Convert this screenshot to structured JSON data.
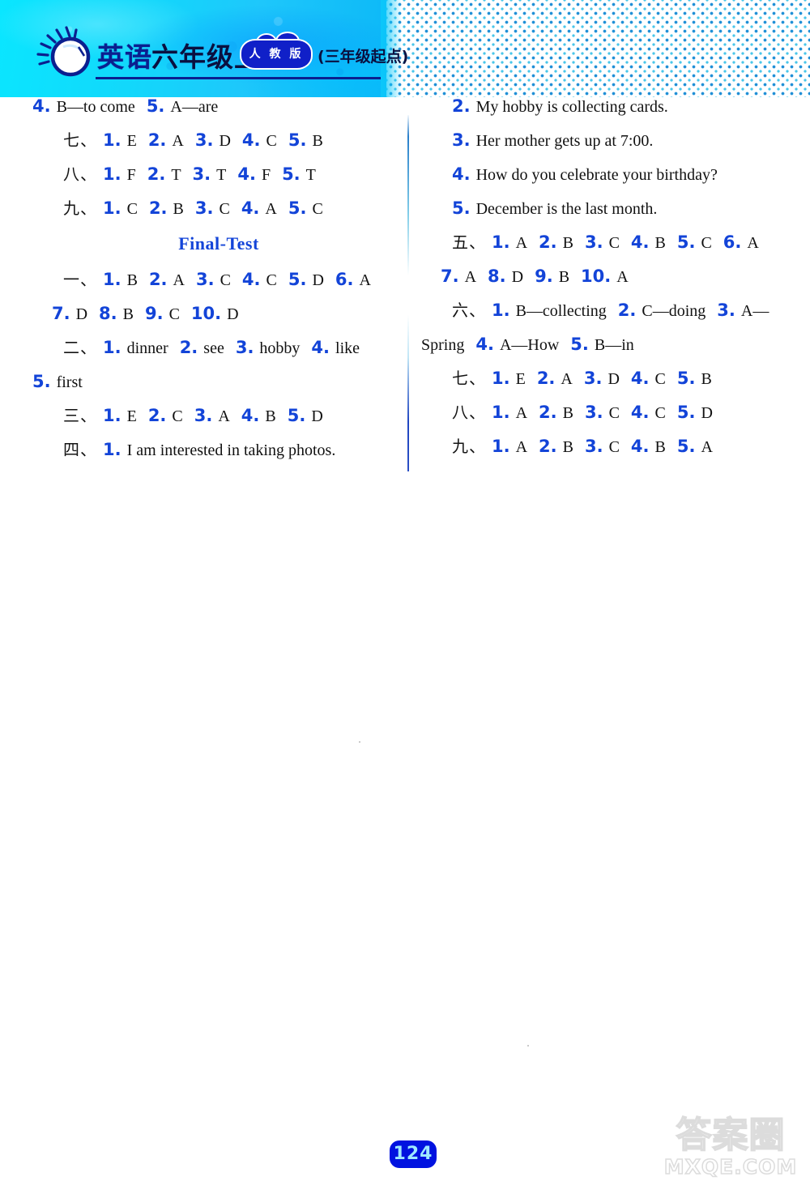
{
  "header": {
    "logo_icon": "sun-pearl-icon",
    "subject": "英语",
    "grade": "六年级上",
    "publisher_badge": "人 教 版",
    "edition_note": "(三年级起点)"
  },
  "left_column": {
    "lines": [
      {
        "id": "line-prev-4-5",
        "indent": "none",
        "parts": [
          {
            "type": "num",
            "text": "4."
          },
          {
            "type": "ans",
            "text": "B—to come"
          },
          {
            "type": "gap"
          },
          {
            "type": "num",
            "text": "5."
          },
          {
            "type": "ans",
            "text": "A—are"
          }
        ]
      },
      {
        "id": "line-section-7",
        "indent": "full",
        "parts": [
          {
            "type": "cn",
            "text": "七、"
          },
          {
            "type": "num",
            "text": "1."
          },
          {
            "type": "ans",
            "text": "E"
          },
          {
            "type": "gap"
          },
          {
            "type": "num",
            "text": "2."
          },
          {
            "type": "ans",
            "text": "A"
          },
          {
            "type": "gap"
          },
          {
            "type": "num",
            "text": "3."
          },
          {
            "type": "ans",
            "text": "D"
          },
          {
            "type": "gap"
          },
          {
            "type": "num",
            "text": "4."
          },
          {
            "type": "ans",
            "text": "C"
          },
          {
            "type": "gap"
          },
          {
            "type": "num",
            "text": "5."
          },
          {
            "type": "ans",
            "text": "B"
          }
        ]
      },
      {
        "id": "line-section-8",
        "indent": "full",
        "parts": [
          {
            "type": "cn",
            "text": "八、"
          },
          {
            "type": "num",
            "text": "1."
          },
          {
            "type": "ans",
            "text": "F"
          },
          {
            "type": "gap"
          },
          {
            "type": "num",
            "text": "2."
          },
          {
            "type": "ans",
            "text": "T"
          },
          {
            "type": "gap"
          },
          {
            "type": "num",
            "text": "3."
          },
          {
            "type": "ans",
            "text": "T"
          },
          {
            "type": "gap"
          },
          {
            "type": "num",
            "text": "4."
          },
          {
            "type": "ans",
            "text": "F"
          },
          {
            "type": "gap"
          },
          {
            "type": "num",
            "text": "5."
          },
          {
            "type": "ans",
            "text": "T"
          }
        ]
      },
      {
        "id": "line-section-9",
        "indent": "full",
        "parts": [
          {
            "type": "cn",
            "text": "九、"
          },
          {
            "type": "num",
            "text": "1."
          },
          {
            "type": "ans",
            "text": "C"
          },
          {
            "type": "gap"
          },
          {
            "type": "num",
            "text": "2."
          },
          {
            "type": "ans",
            "text": "B"
          },
          {
            "type": "gap"
          },
          {
            "type": "num",
            "text": "3."
          },
          {
            "type": "ans",
            "text": "C"
          },
          {
            "type": "gap"
          },
          {
            "type": "num",
            "text": "4."
          },
          {
            "type": "ans",
            "text": "A"
          },
          {
            "type": "gap"
          },
          {
            "type": "num",
            "text": "5."
          },
          {
            "type": "ans",
            "text": "C"
          }
        ]
      }
    ],
    "section_title": "Final-Test",
    "lines_after": [
      {
        "id": "ft-section-1a",
        "indent": "full",
        "parts": [
          {
            "type": "cn",
            "text": "一、"
          },
          {
            "type": "num",
            "text": "1."
          },
          {
            "type": "ans",
            "text": "B"
          },
          {
            "type": "gap"
          },
          {
            "type": "num",
            "text": "2."
          },
          {
            "type": "ans",
            "text": "A"
          },
          {
            "type": "gap"
          },
          {
            "type": "num",
            "text": "3."
          },
          {
            "type": "ans",
            "text": "C"
          },
          {
            "type": "gap"
          },
          {
            "type": "num",
            "text": "4."
          },
          {
            "type": "ans",
            "text": "C"
          },
          {
            "type": "gap"
          },
          {
            "type": "num",
            "text": "5."
          },
          {
            "type": "ans",
            "text": "D"
          },
          {
            "type": "gap"
          },
          {
            "type": "num",
            "text": "6."
          },
          {
            "type": "ans",
            "text": "A"
          }
        ]
      },
      {
        "id": "ft-section-1b",
        "indent": "small",
        "parts": [
          {
            "type": "num",
            "text": "7."
          },
          {
            "type": "ans",
            "text": "D"
          },
          {
            "type": "gap"
          },
          {
            "type": "num",
            "text": "8."
          },
          {
            "type": "ans",
            "text": "B"
          },
          {
            "type": "gap"
          },
          {
            "type": "num",
            "text": "9."
          },
          {
            "type": "ans",
            "text": "C"
          },
          {
            "type": "gap"
          },
          {
            "type": "num",
            "text": "10."
          },
          {
            "type": "ans",
            "text": "D"
          }
        ]
      },
      {
        "id": "ft-section-2a",
        "indent": "full",
        "parts": [
          {
            "type": "cn",
            "text": "二、"
          },
          {
            "type": "num",
            "text": "1."
          },
          {
            "type": "ans",
            "text": "dinner"
          },
          {
            "type": "gap"
          },
          {
            "type": "num",
            "text": "2."
          },
          {
            "type": "ans",
            "text": "see"
          },
          {
            "type": "gap"
          },
          {
            "type": "num",
            "text": "3."
          },
          {
            "type": "ans",
            "text": "hobby"
          },
          {
            "type": "gap"
          },
          {
            "type": "num",
            "text": "4."
          },
          {
            "type": "ans",
            "text": "like"
          }
        ]
      },
      {
        "id": "ft-section-2b",
        "indent": "none",
        "parts": [
          {
            "type": "num",
            "text": "5."
          },
          {
            "type": "ans",
            "text": "first"
          }
        ]
      },
      {
        "id": "ft-section-3",
        "indent": "full",
        "parts": [
          {
            "type": "cn",
            "text": "三、"
          },
          {
            "type": "num",
            "text": "1."
          },
          {
            "type": "ans",
            "text": "E"
          },
          {
            "type": "gap"
          },
          {
            "type": "num",
            "text": "2."
          },
          {
            "type": "ans",
            "text": "C"
          },
          {
            "type": "gap"
          },
          {
            "type": "num",
            "text": "3."
          },
          {
            "type": "ans",
            "text": "A"
          },
          {
            "type": "gap"
          },
          {
            "type": "num",
            "text": "4."
          },
          {
            "type": "ans",
            "text": "B"
          },
          {
            "type": "gap"
          },
          {
            "type": "num",
            "text": "5."
          },
          {
            "type": "ans",
            "text": "D"
          }
        ]
      },
      {
        "id": "ft-section-4-1",
        "indent": "full",
        "parts": [
          {
            "type": "cn",
            "text": "四、"
          },
          {
            "type": "num",
            "text": "1."
          },
          {
            "type": "ans",
            "text": "I am interested in taking photos."
          }
        ]
      }
    ]
  },
  "right_column": {
    "lines": [
      {
        "id": "ft-section-4-2",
        "indent": "full",
        "parts": [
          {
            "type": "num",
            "text": "2."
          },
          {
            "type": "ans",
            "text": "My hobby is collecting cards."
          }
        ]
      },
      {
        "id": "ft-section-4-3",
        "indent": "full",
        "parts": [
          {
            "type": "num",
            "text": "3."
          },
          {
            "type": "ans",
            "text": "Her mother gets up at 7:00."
          }
        ]
      },
      {
        "id": "ft-section-4-4",
        "indent": "full",
        "parts": [
          {
            "type": "num",
            "text": "4."
          },
          {
            "type": "ans",
            "text": "How do you celebrate your birthday?"
          }
        ]
      },
      {
        "id": "ft-section-4-5",
        "indent": "full",
        "parts": [
          {
            "type": "num",
            "text": "5."
          },
          {
            "type": "ans",
            "text": "December is the last month."
          }
        ]
      },
      {
        "id": "ft-section-5a",
        "indent": "full",
        "parts": [
          {
            "type": "cn",
            "text": "五、"
          },
          {
            "type": "num",
            "text": "1."
          },
          {
            "type": "ans",
            "text": "A"
          },
          {
            "type": "gap"
          },
          {
            "type": "num",
            "text": "2."
          },
          {
            "type": "ans",
            "text": "B"
          },
          {
            "type": "gap"
          },
          {
            "type": "num",
            "text": "3."
          },
          {
            "type": "ans",
            "text": "C"
          },
          {
            "type": "gap"
          },
          {
            "type": "num",
            "text": "4."
          },
          {
            "type": "ans",
            "text": "B"
          },
          {
            "type": "gap"
          },
          {
            "type": "num",
            "text": "5."
          },
          {
            "type": "ans",
            "text": "C"
          },
          {
            "type": "gap"
          },
          {
            "type": "num",
            "text": "6."
          },
          {
            "type": "ans",
            "text": "A"
          }
        ]
      },
      {
        "id": "ft-section-5b",
        "indent": "small",
        "parts": [
          {
            "type": "num",
            "text": "7."
          },
          {
            "type": "ans",
            "text": "A"
          },
          {
            "type": "gap"
          },
          {
            "type": "num",
            "text": "8."
          },
          {
            "type": "ans",
            "text": "D"
          },
          {
            "type": "gap"
          },
          {
            "type": "num",
            "text": "9."
          },
          {
            "type": "ans",
            "text": "B"
          },
          {
            "type": "gap"
          },
          {
            "type": "num",
            "text": "10."
          },
          {
            "type": "ans",
            "text": "A"
          }
        ]
      },
      {
        "id": "ft-section-6a",
        "indent": "full",
        "parts": [
          {
            "type": "cn",
            "text": "六、"
          },
          {
            "type": "num",
            "text": "1."
          },
          {
            "type": "ans",
            "text": "B—collecting"
          },
          {
            "type": "gap"
          },
          {
            "type": "num",
            "text": "2."
          },
          {
            "type": "ans",
            "text": "C—doing"
          },
          {
            "type": "gap"
          },
          {
            "type": "num",
            "text": "3."
          },
          {
            "type": "ans",
            "text": "A—"
          }
        ]
      },
      {
        "id": "ft-section-6b",
        "indent": "none",
        "parts": [
          {
            "type": "ans",
            "text": "Spring"
          },
          {
            "type": "gap"
          },
          {
            "type": "num",
            "text": "4."
          },
          {
            "type": "ans",
            "text": "A—How"
          },
          {
            "type": "gap"
          },
          {
            "type": "num",
            "text": "5."
          },
          {
            "type": "ans",
            "text": "B—in"
          }
        ]
      },
      {
        "id": "ft-section-7",
        "indent": "full",
        "parts": [
          {
            "type": "cn",
            "text": "七、"
          },
          {
            "type": "num",
            "text": "1."
          },
          {
            "type": "ans",
            "text": "E"
          },
          {
            "type": "gap"
          },
          {
            "type": "num",
            "text": "2."
          },
          {
            "type": "ans",
            "text": "A"
          },
          {
            "type": "gap"
          },
          {
            "type": "num",
            "text": "3."
          },
          {
            "type": "ans",
            "text": "D"
          },
          {
            "type": "gap"
          },
          {
            "type": "num",
            "text": "4."
          },
          {
            "type": "ans",
            "text": "C"
          },
          {
            "type": "gap"
          },
          {
            "type": "num",
            "text": "5."
          },
          {
            "type": "ans",
            "text": "B"
          }
        ]
      },
      {
        "id": "ft-section-8",
        "indent": "full",
        "parts": [
          {
            "type": "cn",
            "text": "八、"
          },
          {
            "type": "num",
            "text": "1."
          },
          {
            "type": "ans",
            "text": "A"
          },
          {
            "type": "gap"
          },
          {
            "type": "num",
            "text": "2."
          },
          {
            "type": "ans",
            "text": "B"
          },
          {
            "type": "gap"
          },
          {
            "type": "num",
            "text": "3."
          },
          {
            "type": "ans",
            "text": "C"
          },
          {
            "type": "gap"
          },
          {
            "type": "num",
            "text": "4."
          },
          {
            "type": "ans",
            "text": "C"
          },
          {
            "type": "gap"
          },
          {
            "type": "num",
            "text": "5."
          },
          {
            "type": "ans",
            "text": "D"
          }
        ]
      },
      {
        "id": "ft-section-9",
        "indent": "full",
        "parts": [
          {
            "type": "cn",
            "text": "九、"
          },
          {
            "type": "num",
            "text": "1."
          },
          {
            "type": "ans",
            "text": "A"
          },
          {
            "type": "gap"
          },
          {
            "type": "num",
            "text": "2."
          },
          {
            "type": "ans",
            "text": "B"
          },
          {
            "type": "gap"
          },
          {
            "type": "num",
            "text": "3."
          },
          {
            "type": "ans",
            "text": "C"
          },
          {
            "type": "gap"
          },
          {
            "type": "num",
            "text": "4."
          },
          {
            "type": "ans",
            "text": "B"
          },
          {
            "type": "gap"
          },
          {
            "type": "num",
            "text": "5."
          },
          {
            "type": "ans",
            "text": "A"
          }
        ]
      }
    ]
  },
  "page_number": "124",
  "watermark": {
    "cn": "答案圈",
    "en": "MXQE.COM"
  },
  "colors": {
    "accent_blue": "#1344d8",
    "header_cyan": "#0ae6ff",
    "title_blue": "#0b1f8f",
    "page_badge": "#0012e0"
  }
}
